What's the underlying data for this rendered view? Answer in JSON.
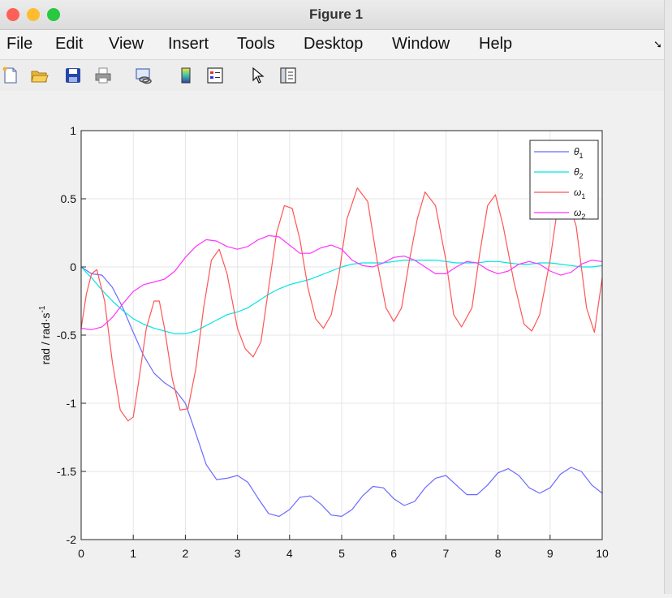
{
  "window": {
    "title": "Figure 1",
    "traffic_lights": [
      "#fe5f57",
      "#febc2e",
      "#28c840"
    ]
  },
  "menu": {
    "items": [
      "File",
      "Edit",
      "View",
      "Insert",
      "Tools",
      "Desktop",
      "Window",
      "Help"
    ],
    "overflow_icon": "dock-arrow-icon"
  },
  "toolbar": {
    "icons": [
      "new-figure-icon",
      "open-file-icon",
      "save-icon",
      "print-icon",
      "link-plot-icon",
      "colorbar-icon",
      "legend-icon",
      "pointer-icon",
      "property-inspector-icon"
    ]
  },
  "chart_data": {
    "type": "line",
    "title": "",
    "xlabel": "",
    "ylabel": "rad / rad·s",
    "ylabel_superscript": "-1",
    "xlim": [
      0,
      10
    ],
    "ylim": [
      -2,
      1
    ],
    "grid": true,
    "legend_position": "top-right",
    "x_ticks": [
      0,
      1,
      2,
      3,
      4,
      5,
      6,
      7,
      8,
      9,
      10
    ],
    "x_tick_labels": [
      "0",
      "1",
      "2",
      "3",
      "4",
      "5",
      "6",
      "7",
      "8",
      "9",
      "10"
    ],
    "y_ticks": [
      1,
      0.5,
      0,
      -0.5,
      -1,
      -1.5,
      -2
    ],
    "y_tick_labels": [
      "1",
      "0.5",
      "0",
      "-0.5",
      "-1",
      "-1.5",
      "-2"
    ],
    "series": [
      {
        "name": "θ",
        "subscript": "1",
        "color": "#6b6bff",
        "x": [
          0,
          0.2,
          0.4,
          0.6,
          0.8,
          1.0,
          1.2,
          1.4,
          1.6,
          1.8,
          2.0,
          2.2,
          2.4,
          2.6,
          2.8,
          3.0,
          3.2,
          3.4,
          3.6,
          3.8,
          4.0,
          4.2,
          4.4,
          4.6,
          4.8,
          5.0,
          5.2,
          5.4,
          5.6,
          5.8,
          6.0,
          6.2,
          6.4,
          6.6,
          6.8,
          7.0,
          7.2,
          7.4,
          7.6,
          7.8,
          8.0,
          8.2,
          8.4,
          8.6,
          8.8,
          9.0,
          9.2,
          9.4,
          9.6,
          9.8,
          10.0
        ],
        "values": [
          0.0,
          -0.05,
          -0.06,
          -0.15,
          -0.3,
          -0.48,
          -0.65,
          -0.78,
          -0.85,
          -0.9,
          -1.0,
          -1.22,
          -1.45,
          -1.56,
          -1.55,
          -1.53,
          -1.58,
          -1.7,
          -1.81,
          -1.83,
          -1.78,
          -1.69,
          -1.68,
          -1.74,
          -1.82,
          -1.83,
          -1.78,
          -1.68,
          -1.61,
          -1.62,
          -1.7,
          -1.75,
          -1.72,
          -1.62,
          -1.55,
          -1.53,
          -1.6,
          -1.67,
          -1.67,
          -1.6,
          -1.51,
          -1.48,
          -1.53,
          -1.62,
          -1.66,
          -1.62,
          -1.52,
          -1.47,
          -1.5,
          -1.6,
          -1.66
        ]
      },
      {
        "name": "θ",
        "subscript": "2",
        "color": "#00e5e5",
        "x": [
          0,
          0.2,
          0.4,
          0.6,
          0.8,
          1.0,
          1.2,
          1.4,
          1.6,
          1.8,
          2.0,
          2.2,
          2.4,
          2.6,
          2.8,
          3.0,
          3.2,
          3.4,
          3.6,
          3.8,
          4.0,
          4.2,
          4.4,
          4.6,
          4.8,
          5.0,
          5.2,
          5.4,
          5.6,
          5.8,
          6.0,
          6.2,
          6.4,
          6.6,
          6.8,
          7.0,
          7.2,
          7.4,
          7.6,
          7.8,
          8.0,
          8.2,
          8.4,
          8.6,
          8.8,
          9.0,
          9.2,
          9.4,
          9.6,
          9.8,
          10.0
        ],
        "values": [
          0.0,
          -0.08,
          -0.17,
          -0.25,
          -0.32,
          -0.38,
          -0.42,
          -0.45,
          -0.47,
          -0.49,
          -0.49,
          -0.47,
          -0.43,
          -0.39,
          -0.35,
          -0.33,
          -0.3,
          -0.25,
          -0.2,
          -0.16,
          -0.13,
          -0.11,
          -0.09,
          -0.06,
          -0.03,
          0.0,
          0.02,
          0.03,
          0.03,
          0.03,
          0.04,
          0.05,
          0.05,
          0.05,
          0.05,
          0.04,
          0.03,
          0.03,
          0.03,
          0.04,
          0.04,
          0.03,
          0.02,
          0.02,
          0.03,
          0.03,
          0.02,
          0.01,
          0.0,
          0.0,
          0.01
        ]
      },
      {
        "name": "ω",
        "subscript": "1",
        "color": "#ff5555",
        "x": [
          0,
          0.1,
          0.2,
          0.3,
          0.45,
          0.6,
          0.75,
          0.9,
          1.0,
          1.1,
          1.25,
          1.4,
          1.5,
          1.6,
          1.75,
          1.9,
          2.05,
          2.2,
          2.35,
          2.5,
          2.65,
          2.8,
          2.9,
          3.0,
          3.15,
          3.3,
          3.45,
          3.6,
          3.75,
          3.9,
          4.05,
          4.2,
          4.35,
          4.5,
          4.65,
          4.8,
          4.95,
          5.1,
          5.3,
          5.5,
          5.7,
          5.85,
          6.0,
          6.15,
          6.3,
          6.45,
          6.6,
          6.8,
          7.0,
          7.15,
          7.3,
          7.5,
          7.65,
          7.8,
          7.95,
          8.1,
          8.3,
          8.5,
          8.65,
          8.8,
          9.0,
          9.15,
          9.3,
          9.5,
          9.7,
          9.85,
          10.0
        ],
        "values": [
          -0.45,
          -0.2,
          -0.05,
          -0.02,
          -0.25,
          -0.7,
          -1.05,
          -1.13,
          -1.1,
          -0.85,
          -0.45,
          -0.25,
          -0.25,
          -0.45,
          -0.82,
          -1.05,
          -1.04,
          -0.75,
          -0.3,
          0.05,
          0.13,
          -0.05,
          -0.25,
          -0.45,
          -0.6,
          -0.66,
          -0.55,
          -0.15,
          0.25,
          0.45,
          0.43,
          0.2,
          -0.15,
          -0.38,
          -0.45,
          -0.35,
          -0.05,
          0.35,
          0.58,
          0.48,
          0.0,
          -0.3,
          -0.4,
          -0.3,
          0.05,
          0.35,
          0.55,
          0.45,
          0.05,
          -0.35,
          -0.44,
          -0.3,
          0.1,
          0.45,
          0.53,
          0.3,
          -0.1,
          -0.42,
          -0.47,
          -0.35,
          0.05,
          0.45,
          0.55,
          0.3,
          -0.3,
          -0.48,
          -0.08
        ]
      },
      {
        "name": "ω",
        "subscript": "2",
        "color": "#ff33ff",
        "x": [
          0,
          0.2,
          0.4,
          0.6,
          0.8,
          1.0,
          1.2,
          1.4,
          1.6,
          1.8,
          2.0,
          2.2,
          2.4,
          2.6,
          2.8,
          3.0,
          3.2,
          3.4,
          3.6,
          3.8,
          4.0,
          4.2,
          4.4,
          4.6,
          4.8,
          5.0,
          5.2,
          5.4,
          5.6,
          5.8,
          6.0,
          6.2,
          6.4,
          6.6,
          6.8,
          7.0,
          7.2,
          7.4,
          7.6,
          7.8,
          8.0,
          8.2,
          8.4,
          8.6,
          8.8,
          9.0,
          9.2,
          9.4,
          9.6,
          9.8,
          10.0
        ],
        "values": [
          -0.45,
          -0.46,
          -0.44,
          -0.37,
          -0.27,
          -0.18,
          -0.13,
          -0.11,
          -0.09,
          -0.03,
          0.07,
          0.15,
          0.2,
          0.19,
          0.15,
          0.13,
          0.15,
          0.2,
          0.23,
          0.22,
          0.16,
          0.1,
          0.1,
          0.14,
          0.16,
          0.13,
          0.05,
          0.01,
          0.0,
          0.03,
          0.07,
          0.08,
          0.05,
          0.0,
          -0.05,
          -0.05,
          0.0,
          0.04,
          0.03,
          -0.02,
          -0.05,
          -0.03,
          0.02,
          0.04,
          0.02,
          -0.03,
          -0.06,
          -0.04,
          0.02,
          0.05,
          0.04
        ]
      }
    ]
  }
}
